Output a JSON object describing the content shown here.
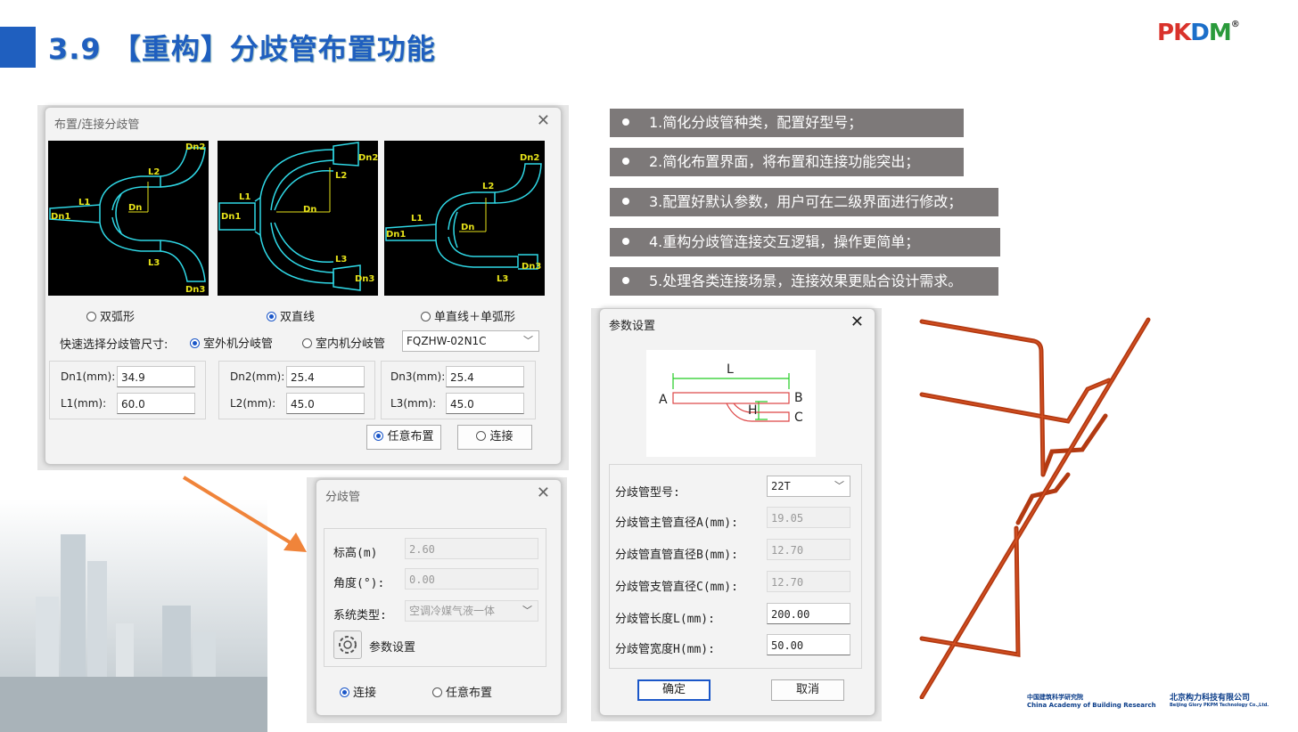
{
  "slide": {
    "title": "3.9 【重构】分歧管布置功能",
    "logo": {
      "text_p": "P",
      "text_k": "K",
      "text_d": "D",
      "text_m": "M",
      "reg": "®"
    }
  },
  "bullets": [
    "1.简化分歧管种类，配置好型号；",
    "2.简化布置界面，将布置和连接功能突出；",
    "3.配置好默认参数，用户可在二级界面进行修改；",
    "4.重构分歧管连接交互逻辑，操作更简单；",
    "5.处理各类连接场景，连接效果更贴合设计需求。"
  ],
  "layout_dialog": {
    "title": "布置/连接分歧管",
    "close": "✕",
    "diagram_labels": {
      "dn1": "Dn1",
      "dn2": "Dn2",
      "dn3": "Dn3",
      "dn": "Dn",
      "l1": "L1",
      "l2": "L2",
      "l3": "L3"
    },
    "shape_options": [
      {
        "label": "双弧形",
        "selected": false
      },
      {
        "label": "双直线",
        "selected": true
      },
      {
        "label": "单直线＋单弧形",
        "selected": false
      }
    ],
    "quick_label": "快速选择分歧管尺寸:",
    "size_options": [
      {
        "label": "室外机分岐管",
        "selected": true
      },
      {
        "label": "室内机分岐管",
        "selected": false
      }
    ],
    "model_select": "FQZHW-02N1C",
    "fields": {
      "dn1_label": "Dn1(mm):",
      "dn1": "34.9",
      "l1_label": "L1(mm):",
      "l1": "60.0",
      "dn2_label": "Dn2(mm):",
      "dn2": "25.4",
      "l2_label": "L2(mm):",
      "l2": "45.0",
      "dn3_label": "Dn3(mm):",
      "dn3": "25.4",
      "l3_label": "L3(mm):",
      "l3": "45.0"
    },
    "buttons": {
      "free": "任意布置",
      "connect": "连接"
    }
  },
  "branch_dialog": {
    "title": "分歧管",
    "close": "✕",
    "elev_label": "标高(m)",
    "elev": "2.60",
    "angle_label": "角度(°):",
    "angle": "0.00",
    "system_label": "系统类型:",
    "system": "空调冷媒气液一体",
    "param_btn": "参数设置",
    "radio_connect": "连接",
    "radio_free": "任意布置"
  },
  "param_dialog": {
    "title": "参数设置",
    "close": "✕",
    "diagram_labels": {
      "l": "L",
      "a": "A",
      "b": "B",
      "c": "C",
      "h": "H"
    },
    "model_label": "分歧管型号:",
    "model": "22T",
    "diam_a_label": "分歧管主管直径A(mm):",
    "diam_a": "19.05",
    "diam_b_label": "分歧管直管直径B(mm):",
    "diam_b": "12.70",
    "diam_c_label": "分歧管支管直径C(mm):",
    "diam_c": "12.70",
    "len_label": "分歧管长度L(mm):",
    "len": "200.00",
    "width_label": "分歧管宽度H(mm):",
    "width": "50.00",
    "ok": "确定",
    "cancel": "取消"
  },
  "footer": {
    "cabr": "China Academy of Building Research",
    "cabr_cn": "中国建筑科学研究院",
    "glory_cn": "北京构力科技有限公司",
    "glory_en": "Beijing Glory PKPM Technology Co.,Ltd."
  },
  "colors": {
    "title_blue": "#1f5fbf",
    "bullet_bg": "#7d7979",
    "pipe_red": "#b33a12",
    "diagram_cyan": "#2fd8e6",
    "diagram_yellow": "#e6e21a"
  }
}
